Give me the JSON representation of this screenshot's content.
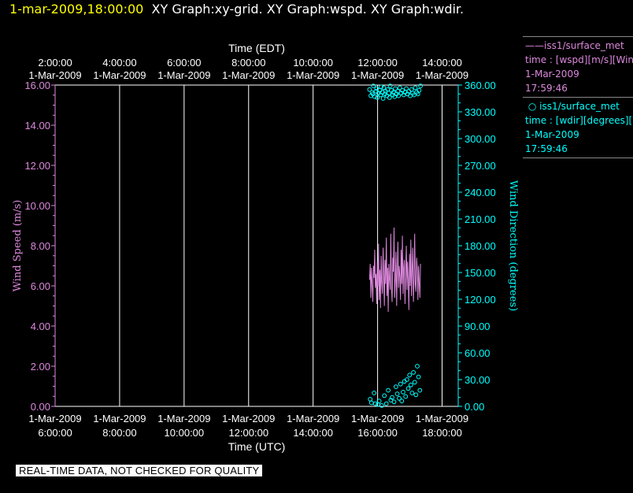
{
  "header": {
    "timestamp": "1-mar-2009,18:00:00",
    "graphs": "XY Graph:xy-grid.  XY Graph:wspd.  XY Graph:wdir."
  },
  "legend": [
    {
      "symbol": "——",
      "name": "iss1/surface_met",
      "desc": "time : [wspd][m/s][Wind Speed]",
      "date": "1-Mar-2009",
      "time": "17:59:46",
      "color": "#dd88dd"
    },
    {
      "symbol": "○",
      "name": "iss1/surface_met",
      "desc": "time : [wdir][degrees][Wind Direction]",
      "date": "1-Mar-2009",
      "time": "17:59:46",
      "color": "#00ffff"
    }
  ],
  "banner": "REAL-TIME DATA, NOT CHECKED FOR QUALITY",
  "colors": {
    "wspd": "#dd88dd",
    "wdir": "#00ffff",
    "grid": "#ffffff",
    "title": "#ffff00"
  },
  "chart_data": {
    "type": "line+scatter",
    "x_label_top": "Time (EDT)",
    "x_label_bottom": "Time (UTC)",
    "y_label_left": "Wind Speed (m/s)",
    "y_label_right": "Wind Direction (degrees)",
    "x_range_utc_hours": [
      6.0,
      18.5
    ],
    "x_ticks_bottom": [
      {
        "date": "1-Mar-2009",
        "time": "6:00:00",
        "h": 6
      },
      {
        "date": "1-Mar-2009",
        "time": "8:00:00",
        "h": 8
      },
      {
        "date": "1-Mar-2009",
        "time": "10:00:00",
        "h": 10
      },
      {
        "date": "1-Mar-2009",
        "time": "12:00:00",
        "h": 12
      },
      {
        "date": "1-Mar-2009",
        "time": "14:00:00",
        "h": 14
      },
      {
        "date": "1-Mar-2009",
        "time": "16:00:00",
        "h": 16
      },
      {
        "date": "1-Mar-2009",
        "time": "18:00:00",
        "h": 18
      }
    ],
    "x_ticks_top": [
      {
        "time": "2:00:00",
        "date": "1-Mar-2009",
        "h": 6
      },
      {
        "time": "4:00:00",
        "date": "1-Mar-2009",
        "h": 8
      },
      {
        "time": "6:00:00",
        "date": "1-Mar-2009",
        "h": 10
      },
      {
        "time": "8:00:00",
        "date": "1-Mar-2009",
        "h": 12
      },
      {
        "time": "10:00:00",
        "date": "1-Mar-2009",
        "h": 14
      },
      {
        "time": "12:00:00",
        "date": "1-Mar-2009",
        "h": 16
      },
      {
        "time": "14:00:00",
        "date": "1-Mar-2009",
        "h": 18
      }
    ],
    "y_left_range": [
      0,
      16
    ],
    "y_left_ticks": [
      "0.00",
      "2.00",
      "4.00",
      "6.00",
      "8.00",
      "10.00",
      "12.00",
      "14.00",
      "16.00"
    ],
    "y_right_range": [
      0,
      360
    ],
    "y_right_ticks": [
      "0.00",
      "30.00",
      "60.00",
      "90.00",
      "120.00",
      "150.00",
      "180.00",
      "210.00",
      "240.00",
      "270.00",
      "300.00",
      "330.00",
      "360.00"
    ],
    "series": [
      {
        "name": "iss1/surface_met",
        "field": "wspd",
        "style": "line",
        "time_start_h": 15.75,
        "time_step_h": 0.02,
        "values": [
          6.3,
          7.1,
          5.4,
          6.9,
          6.1,
          5.2,
          7.0,
          6.4,
          7.8,
          5.9,
          6.6,
          5.1,
          7.2,
          6.0,
          8.1,
          5.3,
          6.8,
          4.9,
          7.5,
          6.2,
          5.6,
          7.9,
          6.5,
          5.0,
          7.3,
          6.1,
          8.4,
          5.5,
          6.9,
          4.7,
          7.1,
          6.3,
          5.8,
          8.6,
          6.0,
          5.2,
          7.4,
          6.7,
          8.9,
          5.4,
          6.2,
          7.7,
          5.0,
          6.8,
          8.2,
          5.9,
          7.0,
          6.4,
          5.3,
          7.8,
          6.1,
          8.5,
          5.6,
          6.9,
          7.3,
          5.1,
          6.6,
          8.0,
          5.8,
          7.2,
          6.3,
          4.8,
          7.6,
          6.0,
          8.3,
          5.5,
          6.7,
          7.9,
          5.2,
          6.4,
          8.6,
          6.1,
          5.7,
          7.4,
          6.8,
          5.3,
          7.0,
          6.2,
          5.4,
          7.1
        ]
      },
      {
        "name": "iss1/surface_met",
        "field": "wdir",
        "style": "circles",
        "time_start_h": 15.75,
        "time_step_h": 0.02,
        "values": [
          355,
          8,
          348,
          4,
          352,
          350,
          359,
          15,
          347,
          3,
          353,
          356,
          346,
          2,
          351,
          6,
          354,
          349,
          358,
          1,
          352,
          345,
          357,
          12,
          350,
          353,
          3,
          348,
          355,
          18,
          351,
          346,
          359,
          7,
          354,
          10,
          349,
          352,
          5,
          347,
          356,
          22,
          350,
          14,
          353,
          348,
          9,
          357,
          25,
          351,
          6,
          354,
          16,
          349,
          28,
          352,
          11,
          356,
          30,
          350,
          20,
          353,
          35,
          348,
          24,
          355,
          15,
          351,
          38,
          349,
          27,
          357,
          13,
          352,
          45,
          350,
          33,
          354,
          18,
          359
        ]
      }
    ]
  }
}
